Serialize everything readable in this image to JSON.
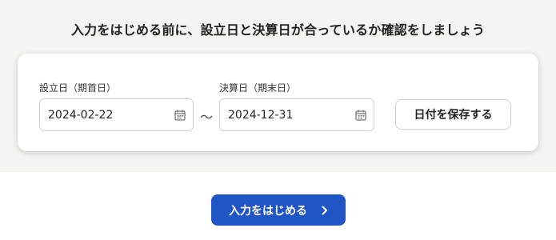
{
  "heading": "入力をはじめる前に、設立日と決算日が合っているか確認をしましょう",
  "form": {
    "start_label": "設立日（期首日）",
    "start_value": "2024-02-22",
    "separator": "～",
    "end_label": "決算日（期末日）",
    "end_value": "2024-12-31",
    "save_label": "日付を保存する",
    "calendar_icon": "calendar-icon"
  },
  "footer": {
    "start_label": "入力をはじめる",
    "start_icon": "chevron-right-icon"
  },
  "colors": {
    "background_top": "#f4f4f3",
    "primary": "#1f55c4",
    "border": "#cfcfcf"
  }
}
